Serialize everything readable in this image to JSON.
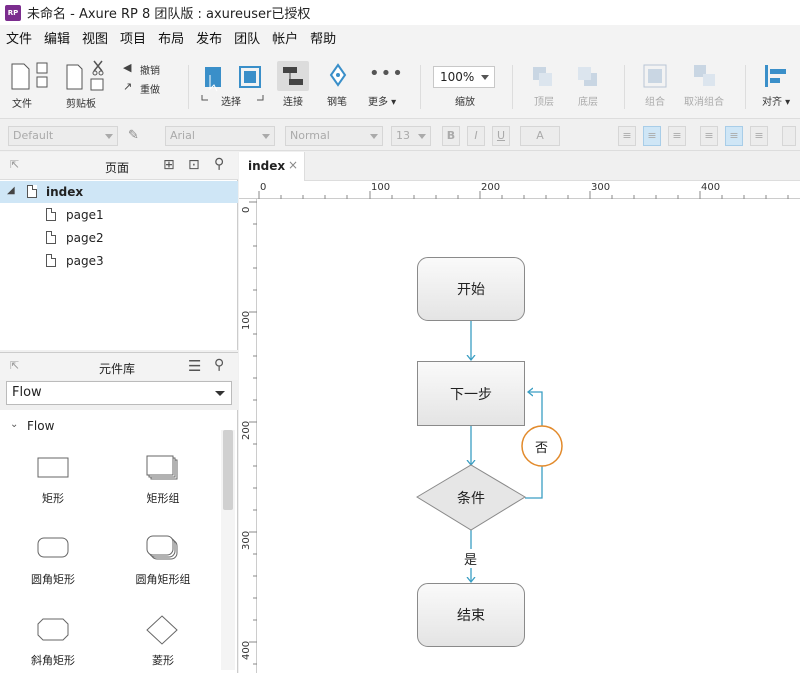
{
  "window": {
    "logo": "RP",
    "title": "未命名 - Axure RP 8 团队版 : axureuser已授权"
  },
  "menu": [
    "文件",
    "编辑",
    "视图",
    "项目",
    "布局",
    "发布",
    "团队",
    "帐户",
    "帮助"
  ],
  "toolbar": {
    "file": "文件",
    "clipboard": "剪贴板",
    "undo": "撤销",
    "redo": "重做",
    "select": "选择",
    "connect": "连接",
    "pen": "钢笔",
    "more": "更多 ▾",
    "zoom_value": "100%",
    "zoom_label": "缩放",
    "top": "顶层",
    "bottom": "底层",
    "group": "组合",
    "ungroup": "取消组合",
    "align": "对齐 ▾"
  },
  "formatbar": {
    "style": "Default",
    "font": "Arial",
    "weight": "Normal",
    "size": "13",
    "bold": "B",
    "italic": "I",
    "underline": "U",
    "color": "A"
  },
  "pages_panel": {
    "title": "页面",
    "pages": [
      {
        "label": "index",
        "selected": true
      },
      {
        "label": "page1"
      },
      {
        "label": "page2"
      },
      {
        "label": "page3"
      }
    ]
  },
  "library_panel": {
    "title": "元件库",
    "selected_library": "Flow",
    "category": "Flow",
    "widgets": [
      "矩形",
      "矩形组",
      "圆角矩形",
      "圆角矩形组",
      "斜角矩形",
      "菱形"
    ]
  },
  "canvas": {
    "tab": "index",
    "tab_close": "×",
    "ruler_h": [
      "0",
      "100",
      "200",
      "300",
      "400"
    ],
    "ruler_v": [
      "0",
      "100",
      "200",
      "300",
      "400"
    ],
    "flow": {
      "start": "开始",
      "next": "下一步",
      "condition": "条件",
      "no": "否",
      "yes": "是",
      "end": "结束"
    }
  },
  "colors": {
    "connector": "#3a9ec3",
    "no_circle": "#e28a2b",
    "selection": "#cfe6f6"
  }
}
